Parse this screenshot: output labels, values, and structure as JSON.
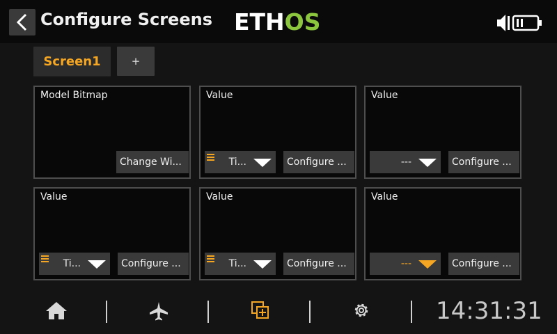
{
  "header": {
    "title": "Configure Screens",
    "brand_part1": "ETH",
    "brand_part2": "OS",
    "back_icon": "chevron-left-icon",
    "status_icons": [
      "speaker-icon",
      "battery-icon"
    ]
  },
  "tabs": [
    {
      "label": "Screen1",
      "selected": true
    },
    {
      "label": "+",
      "selected": false
    }
  ],
  "widgets": [
    {
      "title": "Model Bitmap",
      "button": "Change Wi..."
    },
    {
      "title": "Value",
      "source": "Ti...",
      "button": "Configure ..."
    },
    {
      "title": "Value",
      "source": "---",
      "button": "Configure ..."
    },
    {
      "title": "Value",
      "source": "Ti...",
      "button": "Configure ..."
    },
    {
      "title": "Value",
      "source": "Ti...",
      "button": "Configure ..."
    },
    {
      "title": "Value",
      "source": "---",
      "button": "Configure ..."
    }
  ],
  "footer": {
    "nav": [
      "home-icon",
      "airplane-icon",
      "screens-icon",
      "gear-icon"
    ],
    "active_nav": "screens-icon",
    "clock": "14:31:31"
  },
  "colors": {
    "accent": "#f5a623",
    "brand_green": "#8cc63f",
    "background": "#141414"
  }
}
